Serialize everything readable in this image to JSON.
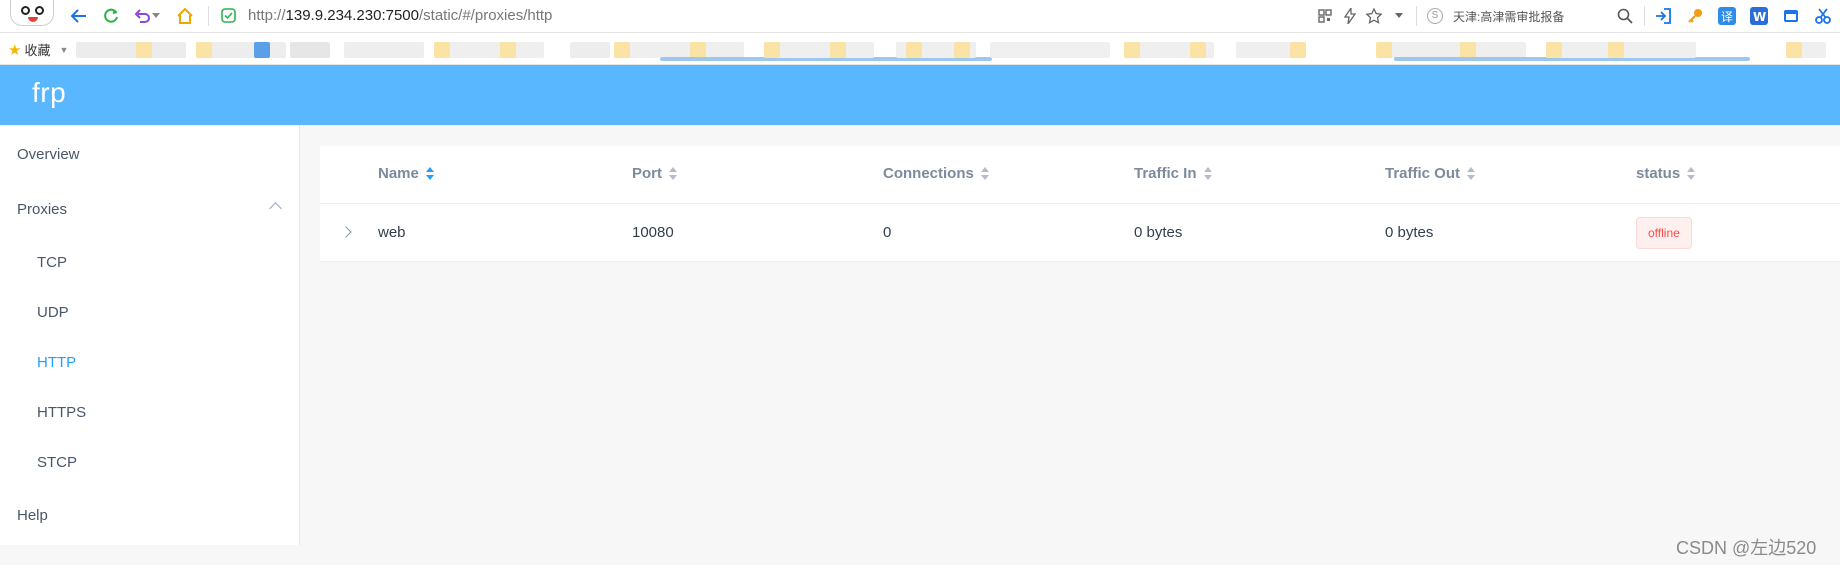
{
  "browser": {
    "url_scheme": "http://",
    "url_host": "139.9.234.230:7500",
    "url_path": "/static/#/proxies/http",
    "search_text": "天津:高津需审批报备",
    "search_badge": "S",
    "bookmarks_label": "收藏"
  },
  "app": {
    "logo": "frp",
    "accent_color": "#58b7ff",
    "active_color": "#20a0ff"
  },
  "sidebar": {
    "items": [
      {
        "label": "Overview"
      },
      {
        "label": "Proxies"
      },
      {
        "label": "TCP"
      },
      {
        "label": "UDP"
      },
      {
        "label": "HTTP"
      },
      {
        "label": "HTTPS"
      },
      {
        "label": "STCP"
      },
      {
        "label": "Help"
      }
    ]
  },
  "table": {
    "columns": [
      {
        "label": "Name",
        "sort": "ascending"
      },
      {
        "label": "Port",
        "sort": "none"
      },
      {
        "label": "Connections",
        "sort": "none"
      },
      {
        "label": "Traffic In",
        "sort": "none"
      },
      {
        "label": "Traffic Out",
        "sort": "none"
      },
      {
        "label": "status",
        "sort": "none"
      }
    ],
    "rows": [
      {
        "name": "web",
        "port": "10080",
        "connections": "0",
        "traffic_in": "0 bytes",
        "traffic_out": "0 bytes",
        "status": "offline"
      }
    ]
  },
  "watermark": "CSDN @左边520"
}
